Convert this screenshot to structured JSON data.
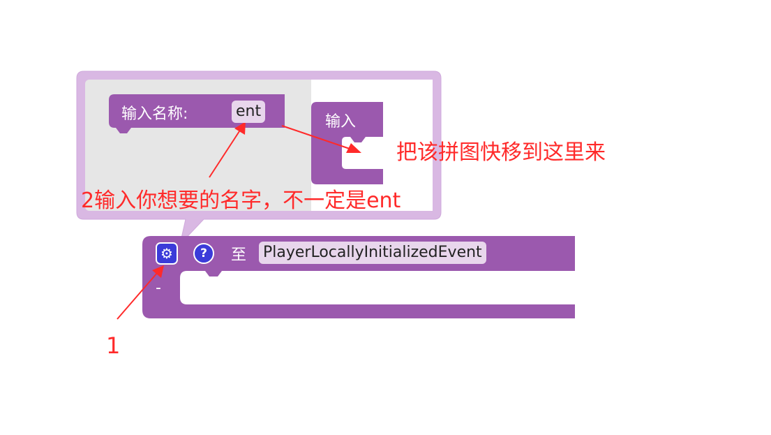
{
  "colors": {
    "block": "#9b59ae",
    "block_dark": "#8a4b9c",
    "bubble_border": "#d9b8e3",
    "bubble_fill": "#e6e6e6",
    "pill": "#e8d6ec",
    "annotation": "#ff2a2a",
    "button": "#3b3bd9"
  },
  "mutator": {
    "name_block_label": "输入名称:",
    "name_value": "ent",
    "container_block_label": "输入"
  },
  "event_block": {
    "keyword": "至",
    "event_name": "PlayerLocallyInitializedEvent",
    "statement_label": "-",
    "gear_icon": "gear-icon",
    "help_icon": "question-icon",
    "help_glyph": "?"
  },
  "annotations": {
    "move_hint": "把该拼图快移到这里来",
    "rename_hint": "2输入你想要的名字，不一定是ent",
    "step_one": "1"
  }
}
